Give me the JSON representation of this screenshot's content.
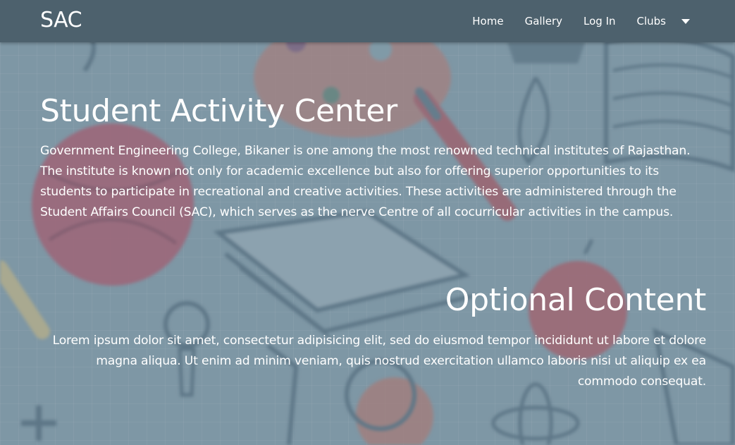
{
  "navbar": {
    "brand": "SAC",
    "links": [
      "Home",
      "Gallery",
      "Log In",
      "Clubs"
    ]
  },
  "main": {
    "title": "Student Activity Center",
    "description": "Government Engineering College, Bikaner is one among the most renowned technical institutes of Rajasthan. The institute is known not only for academic excellence but also for offering superior opportunities to its students to participate in recreational and creative activities. These activities are administered through the Student Affairs Council (SAC), which serves as the nerve Centre of all cocurricular activities in the campus.",
    "optional_title": "Optional Content",
    "optional_text": "Lorem ipsum dolor sit amet, consectetur adipisicing elit, sed do eiusmod tempor incididunt ut labore et dolore magna aliqua. Ut enim ad minim veniam, quis nostrud exercitation ullamco laboris nisi ut aliquip ex ea commodo consequat."
  },
  "colors": {
    "navbar_bg": "#4d616d",
    "text": "#ffffff",
    "accent_red": "#c25a66"
  }
}
